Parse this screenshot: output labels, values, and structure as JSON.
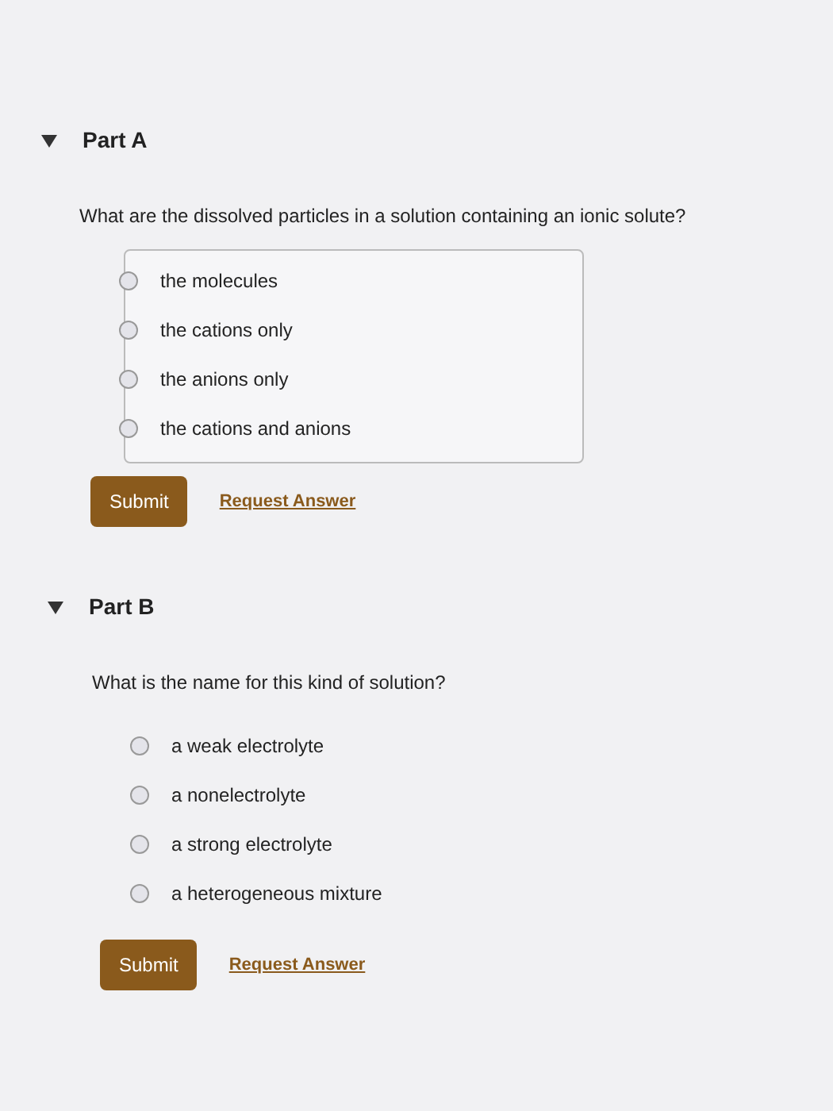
{
  "parts": [
    {
      "title": "Part A",
      "expanded": true,
      "question": "What are the dissolved particles in a solution containing an ionic solute?",
      "bordered": true,
      "options": [
        {
          "label": "the molecules",
          "selected": false
        },
        {
          "label": "the cations only",
          "selected": false
        },
        {
          "label": "the anions only",
          "selected": false
        },
        {
          "label": "the cations and anions",
          "selected": false
        }
      ],
      "submit": "Submit",
      "request": "Request Answer"
    },
    {
      "title": "Part B",
      "expanded": true,
      "question": "What is the name for this kind of solution?",
      "bordered": false,
      "options": [
        {
          "label": "a weak electrolyte",
          "selected": false
        },
        {
          "label": "a nonelectrolyte",
          "selected": false
        },
        {
          "label": "a strong electrolyte",
          "selected": false
        },
        {
          "label": "a heterogeneous mixture",
          "selected": false
        }
      ],
      "submit": "Submit",
      "request": "Request Answer"
    }
  ]
}
